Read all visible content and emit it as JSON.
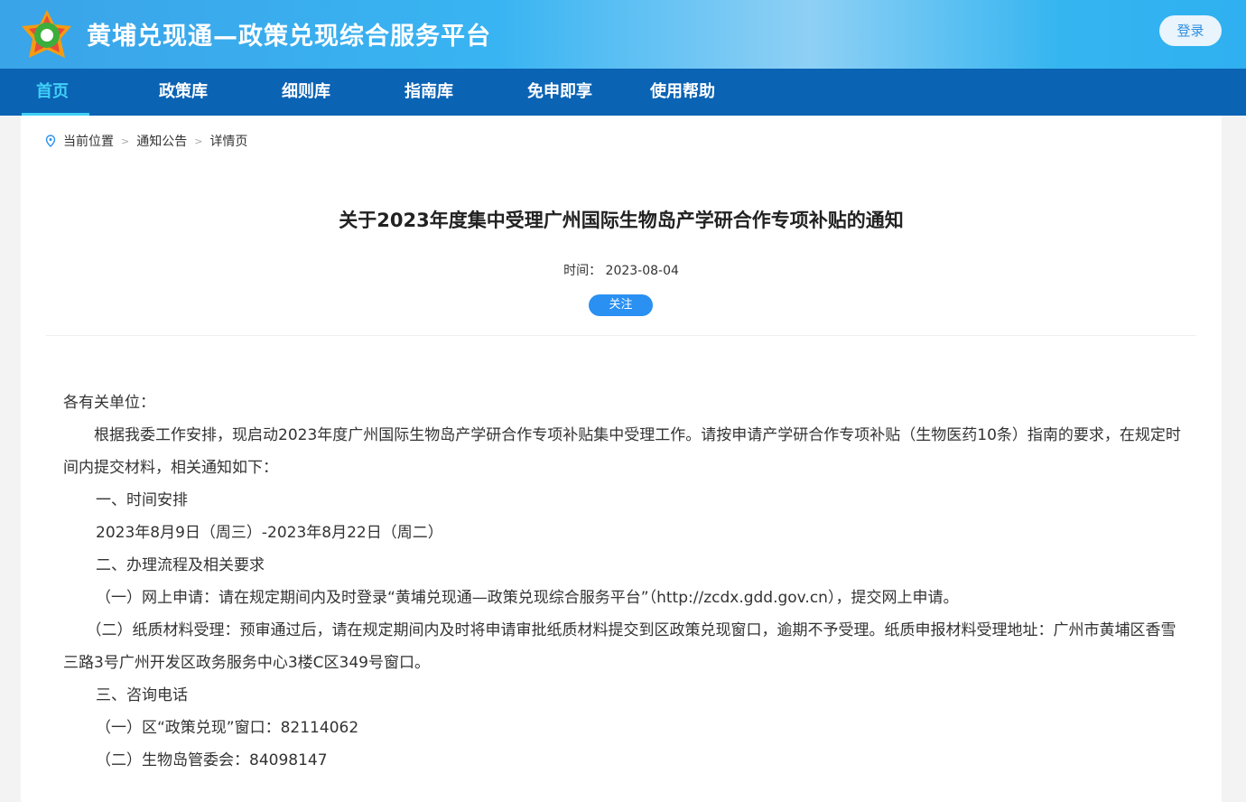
{
  "header": {
    "site_title": "黄埔兑现通—政策兑现综合服务平台",
    "login": "登录"
  },
  "nav": [
    "首页",
    "政策库",
    "细则库",
    "指南库",
    "免申即享",
    "使用帮助"
  ],
  "breadcrumb": [
    "当前位置",
    "通知公告",
    "详情页"
  ],
  "article": {
    "title": "关于2023年度集中受理广州国际生物岛产学研合作专项补贴的通知",
    "time_label": "时间：",
    "time": "2023-08-04",
    "follow": "关注",
    "paragraphs": [
      "各有关单位：",
      "　　根据我委工作安排，现启动2023年度广州国际生物岛产学研合作专项补贴集中受理工作。请按申请产学研合作专项补贴（生物医药10条）指南的要求，在规定时间内提交材料，相关通知如下：",
      "一、时间安排",
      "2023年8月9日（周三）-2023年8月22日（周二）",
      "二、办理流程及相关要求",
      "（一）网上申请：请在规定期间内及时登录“黄埔兑现通—政策兑现综合服务平台”（http://zcdx.gdd.gov.cn），提交网上申请。",
      "　　（二）纸质材料受理：预审通过后，请在规定期间内及时将申请审批纸质材料提交到区政策兑现窗口，逾期不予受理。纸质申报材料受理地址：广州市黄埔区香雪三路3号广州开发区政务服务中心3楼C区349号窗口。",
      "三、咨询电话",
      "（一）区“政策兑现”窗口：82114062",
      "（二）生物岛管委会：84098147"
    ]
  }
}
